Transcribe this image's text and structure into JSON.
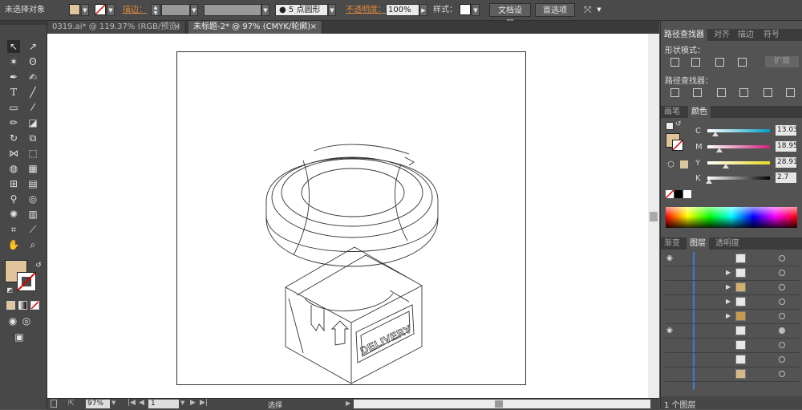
{
  "control_bar": {
    "selection_status": "未选择对象",
    "stroke_label": "描边：",
    "brush_label": "5 点圆形",
    "opacity_label": "不透明度：",
    "opacity_value": "100%",
    "style_label": "样式：",
    "doc_settings": "文档设置",
    "preferences": "首选项"
  },
  "tabs": [
    {
      "label": "0319.ai* @ 119.37% (RGB/预览)",
      "close": "×"
    },
    {
      "label": "未标题-2* @ 97% (CMYK/轮廓)",
      "close": "×"
    }
  ],
  "status_bar": {
    "zoom": "97%",
    "page": "1",
    "tool": "选择"
  },
  "pathfinder": {
    "tabs": [
      "路径查找器",
      "对齐",
      "描边",
      "符号"
    ],
    "shape_modes_label": "形状模式：",
    "expand": "扩展",
    "pathfinders_label": "路径查找器："
  },
  "color_panel": {
    "tabs": [
      "画笔",
      "颜色"
    ],
    "channels": [
      {
        "name": "C",
        "value": "13.03",
        "level": 0.13,
        "color_from": "#ffffff",
        "color_to": "#00a0c8"
      },
      {
        "name": "M",
        "value": "18.95",
        "level": 0.19,
        "color_from": "#ffffff",
        "color_to": "#d0207a"
      },
      {
        "name": "Y",
        "value": "28.91",
        "level": 0.29,
        "color_from": "#ffffff",
        "color_to": "#e8d820"
      },
      {
        "name": "K",
        "value": "2.7",
        "level": 0.03,
        "color_from": "#ffffff",
        "color_to": "#000000"
      }
    ],
    "fill_color": "#e0c49c"
  },
  "layers_panel": {
    "tabs": [
      "渐变",
      "图层",
      "透明度"
    ],
    "layer_count": "1 个图层"
  },
  "artwork": {
    "label_text": "DELIVERY"
  }
}
